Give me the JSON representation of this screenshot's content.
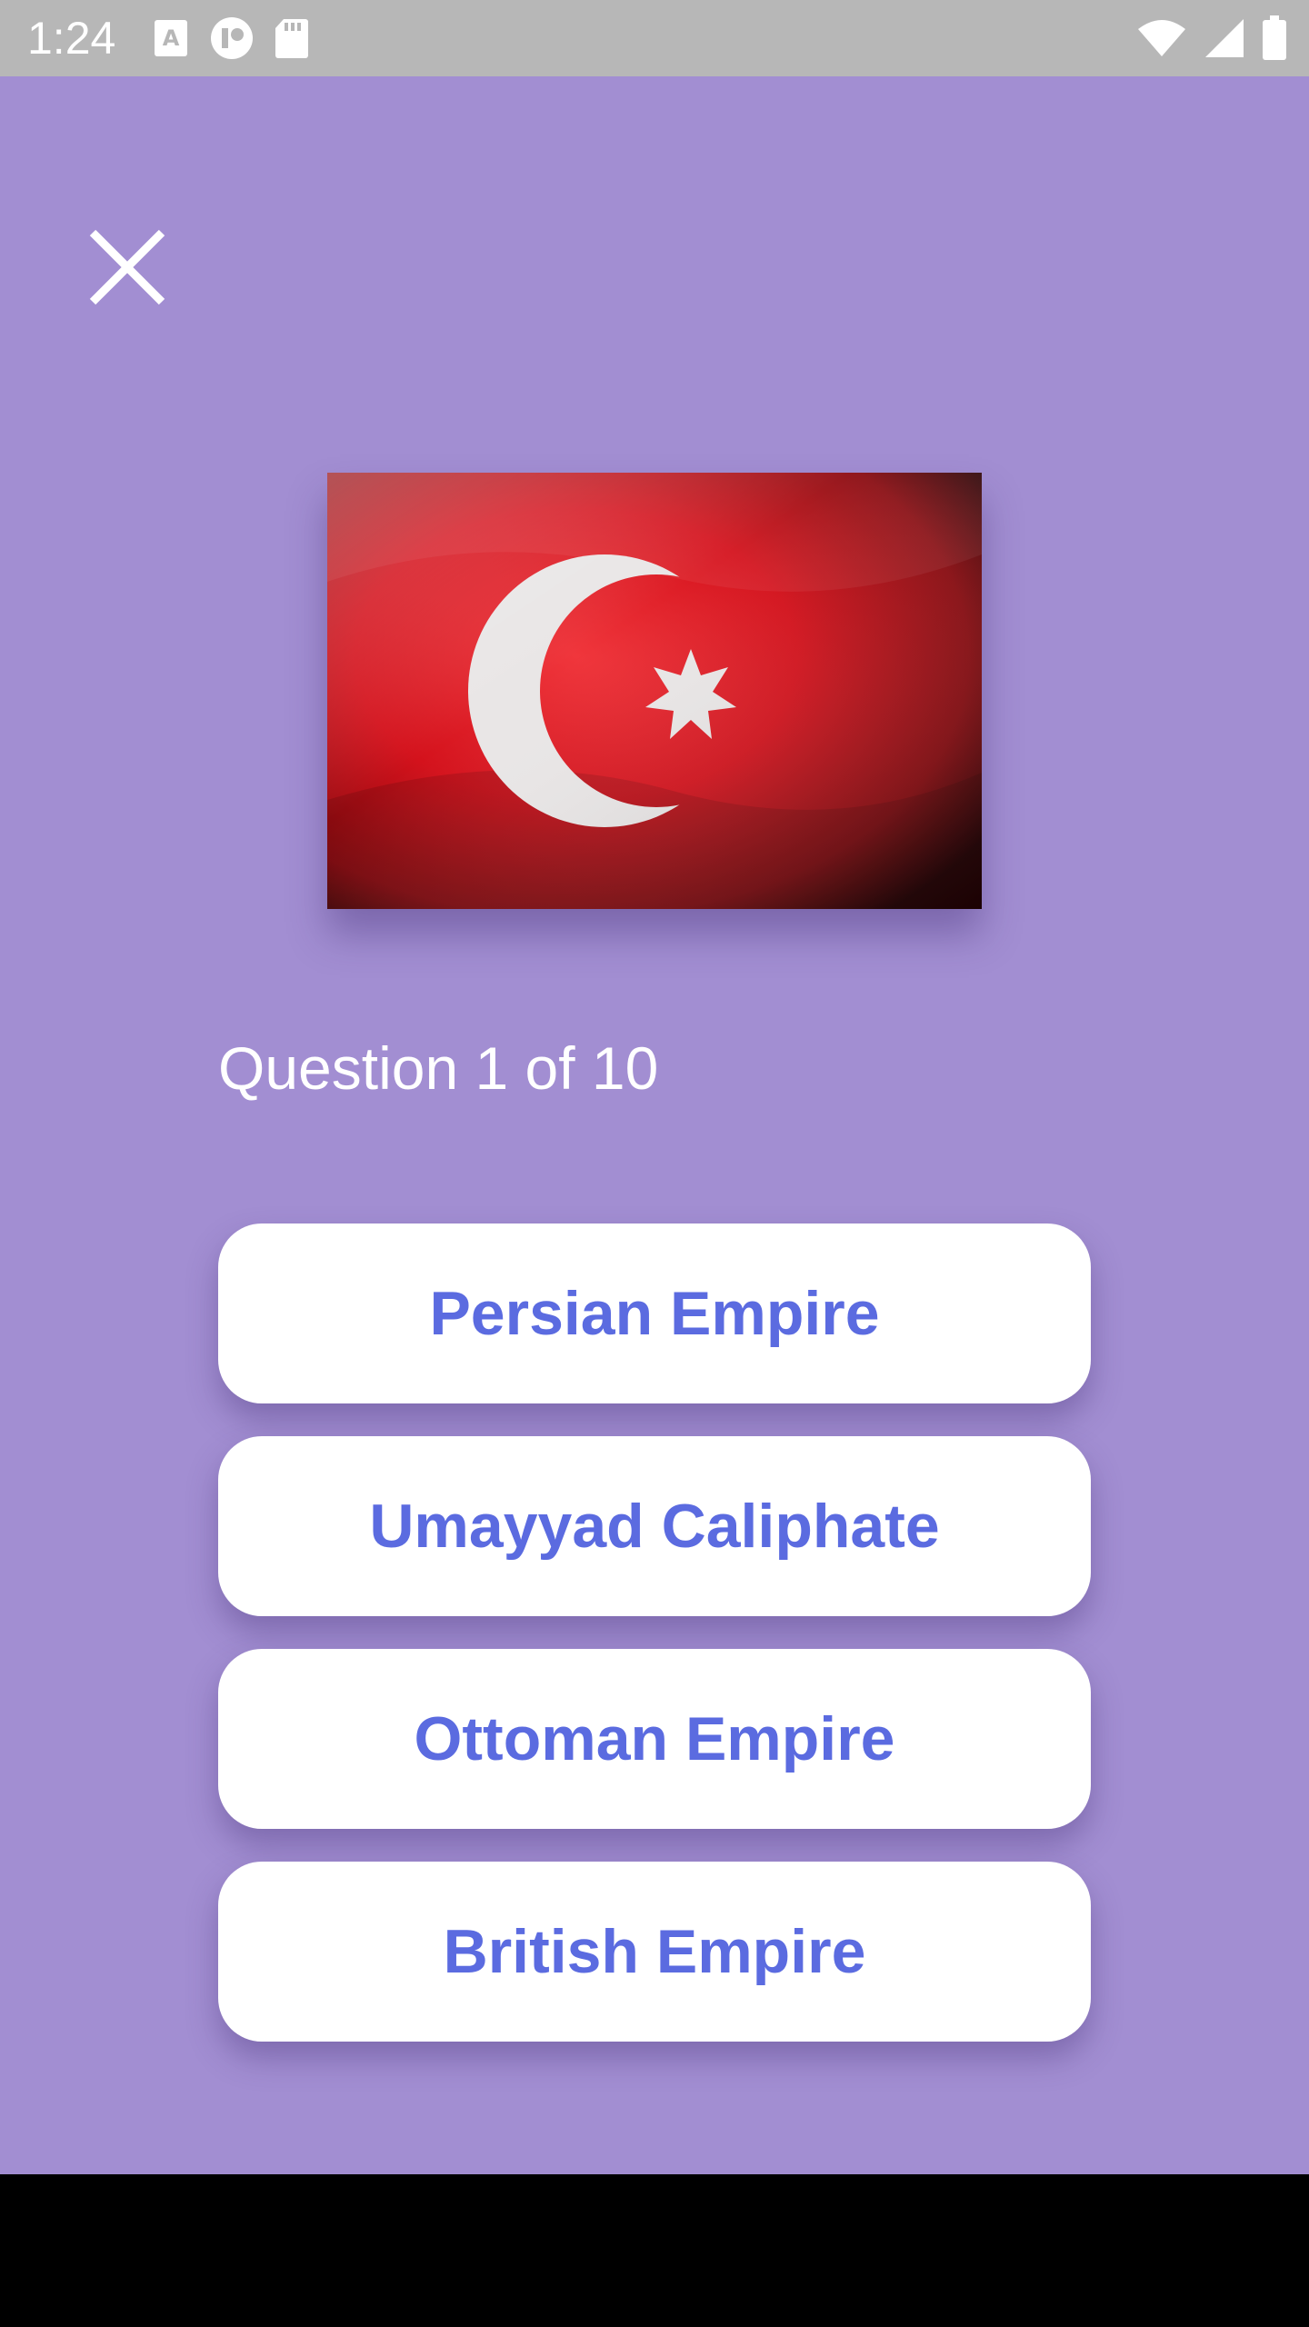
{
  "status_bar": {
    "time": "1:24",
    "left_icons": [
      "font-icon",
      "record-icon",
      "sd-card-icon"
    ],
    "right_icons": [
      "wifi-icon",
      "cellular-signal-icon",
      "battery-icon"
    ],
    "color": "#ffffff"
  },
  "quiz": {
    "close_icon": "close-icon",
    "flag_icon": "ottoman-flag-crescent-star",
    "counter": "Question 1 of 10",
    "answers": [
      {
        "label": "Persian Empire"
      },
      {
        "label": "Umayyad Caliphate"
      },
      {
        "label": "Ottoman Empire"
      },
      {
        "label": "British Empire"
      }
    ]
  },
  "colors": {
    "background": "#a28ed2",
    "button_bg": "#ffffff",
    "button_text": "#5b6be0",
    "status_bar": "#b7b7b7",
    "flag_red": "#d4121c"
  }
}
